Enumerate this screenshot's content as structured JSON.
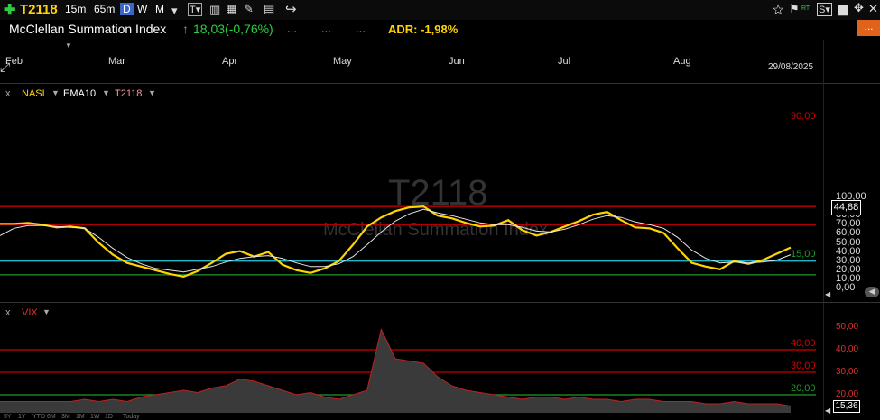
{
  "toolbar": {
    "ticker": "T2118",
    "timeframes": [
      "15m",
      "65m",
      "D",
      "W",
      "M"
    ],
    "active_timeframe": "D"
  },
  "header": {
    "title": "McClellan Summation Index",
    "change": "18,03(-0,76%)",
    "dots": [
      "...",
      "...",
      "..."
    ],
    "adr_label": "ADR: -1,98%",
    "menu": "..."
  },
  "timescale": {
    "months": [
      "Feb",
      "Mar",
      "Apr",
      "May",
      "Jun",
      "Jul",
      "Aug"
    ],
    "date": "29/08/2025"
  },
  "main_panel": {
    "close_label": "x",
    "legend": [
      {
        "name": "NASI",
        "color": "#ffd400"
      },
      {
        "name": "EMA10",
        "color": "#ffffff"
      },
      {
        "name": "T2118",
        "color": "#ff9a9a"
      }
    ],
    "watermark_symbol": "T2118",
    "watermark_name": "McClellan Summation Index",
    "axis_ticks": [
      "100,00",
      "90,00",
      "80,00",
      "70,00",
      "60,00",
      "50,00",
      "40,00",
      "30,00",
      "20,00",
      "10,00",
      "0,00"
    ],
    "last_value": "44,88",
    "levels": [
      {
        "label": "90,00",
        "value": 90,
        "color": "#d40000"
      },
      {
        "label": "",
        "value": 70,
        "color": "#b00000"
      },
      {
        "label": "",
        "value": 30,
        "color": "#1fb5c9"
      },
      {
        "label": "15,00",
        "value": 15,
        "color": "#1f9a2a"
      }
    ]
  },
  "vix_panel": {
    "close_label": "x",
    "legend": "VIX",
    "axis_ticks": [
      "50,00",
      "40,00",
      "30,00",
      "20,00"
    ],
    "last_value": "15,36",
    "levels": [
      {
        "label": "40,00",
        "value": 40,
        "color": "#d40000"
      },
      {
        "label": "30,00",
        "value": 30,
        "color": "#c00000"
      },
      {
        "label": "20,00",
        "value": 20,
        "color": "#1f9a2a"
      }
    ]
  },
  "ranges": [
    "5Y",
    "1Y",
    "YTD",
    "6M",
    "3M",
    "1M",
    "1W",
    "1D",
    "Today"
  ],
  "chart_data": {
    "type": "line",
    "series": [
      {
        "name": "NASI",
        "values": [
          71,
          71,
          72,
          70,
          67,
          68,
          66,
          50,
          37,
          28,
          24,
          20,
          16,
          13,
          19,
          28,
          38,
          41,
          35,
          40,
          26,
          20,
          17,
          22,
          30,
          48,
          68,
          78,
          85,
          89,
          90,
          80,
          77,
          72,
          68,
          69,
          75,
          64,
          58,
          62,
          68,
          74,
          81,
          84,
          75,
          67,
          66,
          61,
          44,
          28,
          24,
          21,
          30,
          27,
          31,
          38,
          45
        ]
      },
      {
        "name": "EMA10",
        "values": [
          58,
          66,
          69,
          69,
          68,
          67,
          66,
          56,
          44,
          34,
          27,
          22,
          20,
          18,
          21,
          24,
          29,
          33,
          35,
          36,
          33,
          28,
          24,
          24,
          27,
          35,
          48,
          62,
          74,
          82,
          87,
          83,
          80,
          76,
          72,
          70,
          70,
          67,
          63,
          62,
          65,
          70,
          76,
          80,
          78,
          73,
          70,
          66,
          56,
          42,
          33,
          28,
          29,
          28,
          29,
          31,
          37
        ]
      },
      {
        "name": "VIX",
        "values": [
          17,
          17,
          17,
          17,
          17,
          17,
          18,
          17,
          18,
          17,
          19,
          20,
          21,
          22,
          21,
          23,
          24,
          27,
          26,
          24,
          22,
          20,
          21,
          19,
          18,
          20,
          22,
          49,
          36,
          35,
          34,
          28,
          24,
          22,
          21,
          20,
          19,
          18,
          19,
          19,
          18,
          19,
          18,
          18,
          17,
          18,
          18,
          17,
          17,
          17,
          16,
          16,
          17,
          16,
          16,
          16,
          15
        ]
      }
    ],
    "main_ylim": [
      0,
      100
    ],
    "vix_ylim": [
      15,
      55
    ]
  }
}
